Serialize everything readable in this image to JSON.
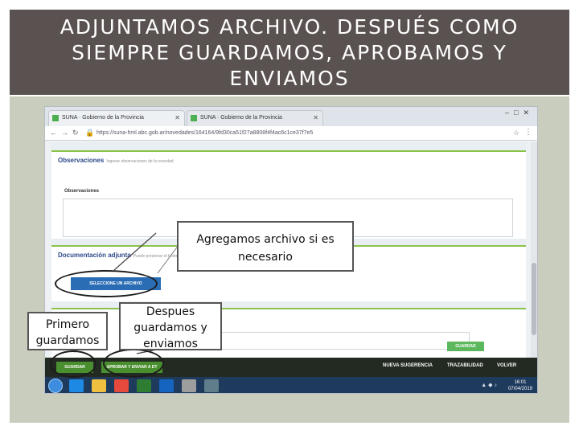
{
  "title": "ADJUNTAMOS ARCHIVO. DESPUÉS COMO SIEMPRE GUARDAMOS, APROBAMOS Y ENVIAMOS",
  "browser": {
    "tabs": [
      {
        "label": "SUNA · Gobierno de la Provincia"
      },
      {
        "label": "SUNA · Gobierno de la Provincia"
      }
    ],
    "url": "https://suna-hml.abc.gob.ar/novedades/164164/9fd30ca51f27a8808f4f4ac6c1ce37f7e5"
  },
  "form": {
    "observaciones_title": "Observaciones",
    "observaciones_hint": "Ingrese observaciones de la novedad",
    "observaciones_label": "Observaciones",
    "documentacion_title": "Documentación adjunta",
    "documentacion_hint": "Puede presionar el botón para seleccionar archivos",
    "select_file_button": "SELECCIONE UN ARCHIVO",
    "guardar_small": "GUARDAR"
  },
  "actionbar": {
    "guardar": "GUARDAR",
    "aprobar_enviar": "APROBAR Y ENVIAR A DT",
    "nueva_sugerencia": "NUEVA SUGERENCIA",
    "trazabilidad": "TRAZABILIDAD",
    "volver": "VOLVER"
  },
  "taskbar": {
    "time": "16:01",
    "date": "07/04/2019"
  },
  "callouts": {
    "agregamos": "Agregamos archivo si es necesario",
    "primero": "Primero guardamos",
    "despues": "Despues guardamos y enviamos"
  },
  "colors": {
    "title_band": "#5a5250",
    "panel": "#c9cdbd",
    "accent_green": "#4a8f2f",
    "button_blue": "#2a6db5"
  }
}
